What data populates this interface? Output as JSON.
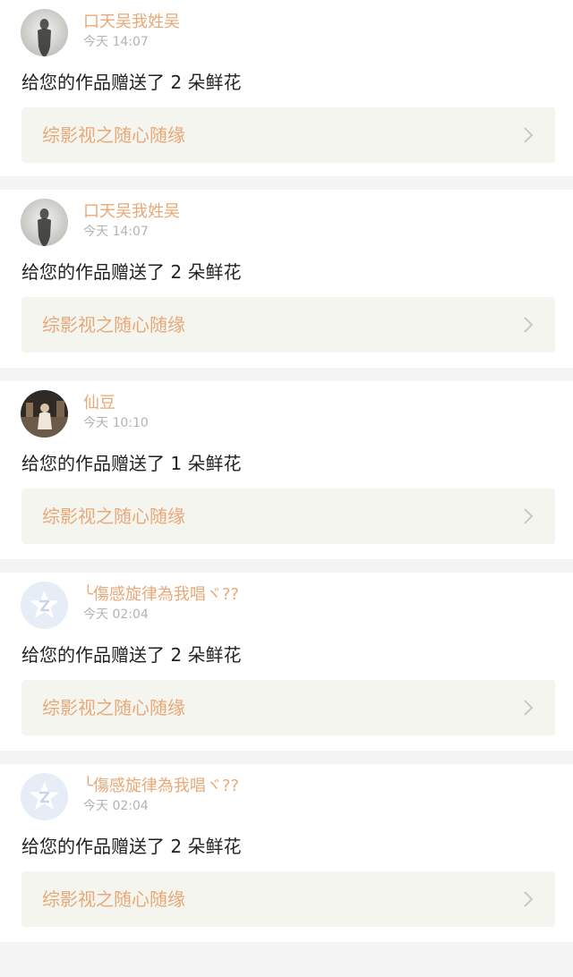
{
  "notifications": [
    {
      "user_name": "口天吴我姓吴",
      "time": "今天 14:07",
      "message": "给您的作品赠送了 2 朵鲜花",
      "work_title": "综影视之随心随缘",
      "avatar_icon": "silhouette-avatar"
    },
    {
      "user_name": "口天吴我姓吴",
      "time": "今天 14:07",
      "message": "给您的作品赠送了 2 朵鲜花",
      "work_title": "综影视之随心随缘",
      "avatar_icon": "silhouette-avatar"
    },
    {
      "user_name": "仙豆",
      "time": "今天 10:10",
      "message": "给您的作品赠送了 1 朵鲜花",
      "work_title": "综影视之随心随缘",
      "avatar_icon": "photo-avatar"
    },
    {
      "user_name": "╰傷感旋律為我唱ヾ??",
      "time": "今天 02:04",
      "message": "给您的作品赠送了 2 朵鲜花",
      "work_title": "综影视之随心随缘",
      "avatar_icon": "default-qzone-avatar"
    },
    {
      "user_name": "╰傷感旋律為我唱ヾ??",
      "time": "今天 02:04",
      "message": "给您的作品赠送了 2 朵鲜花",
      "work_title": "综影视之随心随缘",
      "avatar_icon": "default-qzone-avatar"
    }
  ],
  "colors": {
    "accent": "#e8a877",
    "link_card_bg": "#f5f5ef",
    "page_bg": "#f4f4f4",
    "timestamp": "#b3b3b3"
  }
}
